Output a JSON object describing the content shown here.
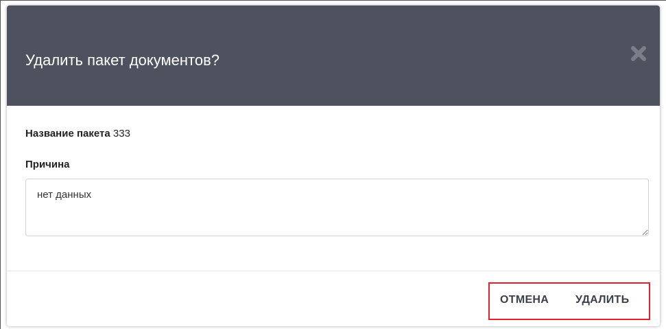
{
  "dialog": {
    "title": "Удалить пакет документов?",
    "close_icon": "close-icon",
    "package_label": "Название пакета",
    "package_value": "333",
    "reason_label": "Причина",
    "reason_value": "нет данных",
    "cancel_label": "ОТМЕНА",
    "delete_label": "УДАЛИТЬ"
  },
  "colors": {
    "header_bg": "#4d525e",
    "highlight_border": "#e0202a",
    "button_text": "#3a3f4b"
  }
}
